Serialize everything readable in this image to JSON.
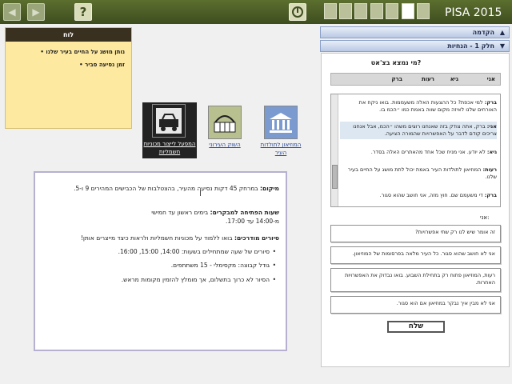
{
  "topbar": {
    "back_glyph": "◀",
    "forward_glyph": "▶",
    "help_glyph": "?",
    "brand": "PISA 2015",
    "progress_total": 7,
    "progress_current_index": 5
  },
  "sections": [
    {
      "label": "הקדמה",
      "chevron": "▲"
    },
    {
      "label": "חלק 1 - הנחיות",
      "chevron": "▼"
    }
  ],
  "board": {
    "title": "לוח",
    "items": [
      "נותן מושג על החיים בעיר שלנו",
      "זמן נסיעה סביר"
    ]
  },
  "options": [
    {
      "label": "המפעל לייצור מכוניות חשמליות",
      "icon": "electric-car-icon",
      "selected": true
    },
    {
      "label": "השוק העירוני",
      "icon": "market-basket-icon",
      "selected": false
    },
    {
      "label": "המוזיאון לתולדות העיר",
      "icon": "museum-icon",
      "selected": false
    }
  ],
  "info": {
    "location_label": "מיקום:",
    "location_text": "במרחק 45 דקות נסיעה מהעיר, בהצטלבות של הכבישים המהירים 9 ו-5.",
    "hours_label": "שעות הפתיחה למבקרים:",
    "hours_text": "בימים ראשון עד חמישי",
    "hours_time": "מ-14:00 עד 17:00.",
    "tours_label": "סיורים מודרכים:",
    "tours_text": "בואו ללמוד על מכוניות חשמליות ולראות כיצד מייצרים אותן!",
    "bullets": [
      "סיורים של שעה שמתחילים בשעות: 14:00, 15:00, 16:00.",
      "גודל קבוצה: מקסימלי - 15 משתתפים.",
      "הסיור לא כרוך בתשלום, אך מומלץ להזמין מקומות מראש."
    ]
  },
  "chat": {
    "question": "מי נמצא בצ'אט?",
    "participants": [
      "אני",
      "גיא",
      "רעות",
      "ברק"
    ],
    "messages": [
      {
        "speaker": "ברק:",
        "text": "למי אכפת? כל ההצעות האלה משעממות. בואו ניקח את האורחים שלנו לאיזה מקום שווה באמת כמו ״הכמ בו.",
        "highlight": false
      },
      {
        "speaker": "אני:",
        "text": "ברק, אתה צודק בזה שאנחנו רוצים משהו ״הכמ, אבל אנחנו צריכים קודם לדבר על האפשרויות שהמורה הציעה.",
        "highlight": true
      },
      {
        "speaker": "גיא:",
        "text": "לא יודע. אני מניח שכל אחד מהאתרים האלה בסדר.",
        "highlight": false
      },
      {
        "speaker": "רעות:",
        "text": "המוזיאון לתולדות העיר באמת יכול לתת מושג על החיים בעיר שלנו.",
        "highlight": false
      },
      {
        "speaker": "ברק:",
        "text": "די משעמם שם. חוץ מזה, אני חושב שהוא סגור.",
        "highlight": false
      }
    ],
    "me_label": "אני:",
    "responses": [
      "זה אומר שיש לנו רק שתי אפשרויות?",
      "אני לא חושב שהוא סגור. כל העיר מלאה בפרסומות של המוזיאון.",
      "רעות, המוזיאון פתוח רק בתחילת השבוע. בואו נבדוק את האפשרויות האחרות.",
      "אני לא מבין איך נבקר במוזיאון אם הוא סגור."
    ],
    "send_label": "שלח"
  }
}
